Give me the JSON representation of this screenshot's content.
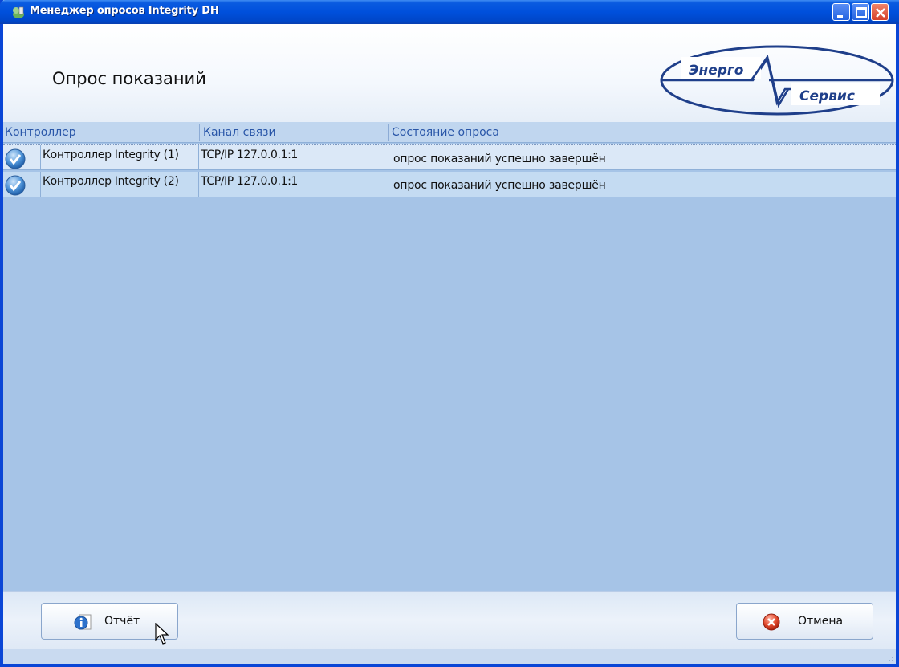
{
  "window": {
    "title": "Менеджер опросов Integrity DH"
  },
  "header": {
    "title": "Опрос показаний",
    "logo_top": "Энерго",
    "logo_bottom": "Сервис"
  },
  "table": {
    "columns": [
      "Контроллер",
      "Канал связи",
      "Состояние опроса"
    ],
    "rows": [
      {
        "controller": "Контроллер Integrity (1)",
        "channel": "TCP/IP 127.0.0.1:1",
        "status": "опрос показаний успешно завершён"
      },
      {
        "controller": "Контроллер Integrity (2)",
        "channel": "TCP/IP 127.0.0.1:1",
        "status": "опрос показаний успешно завершён"
      }
    ]
  },
  "footer": {
    "report_label": "Отчёт",
    "cancel_label": "Отмена"
  },
  "icons": {
    "row_status": "check-circle-icon",
    "report": "info-icon",
    "cancel": "cancel-icon"
  },
  "colors": {
    "titlebar": "#0050dc",
    "panel": "#a6c4e7",
    "header_text": "#2956a8"
  }
}
